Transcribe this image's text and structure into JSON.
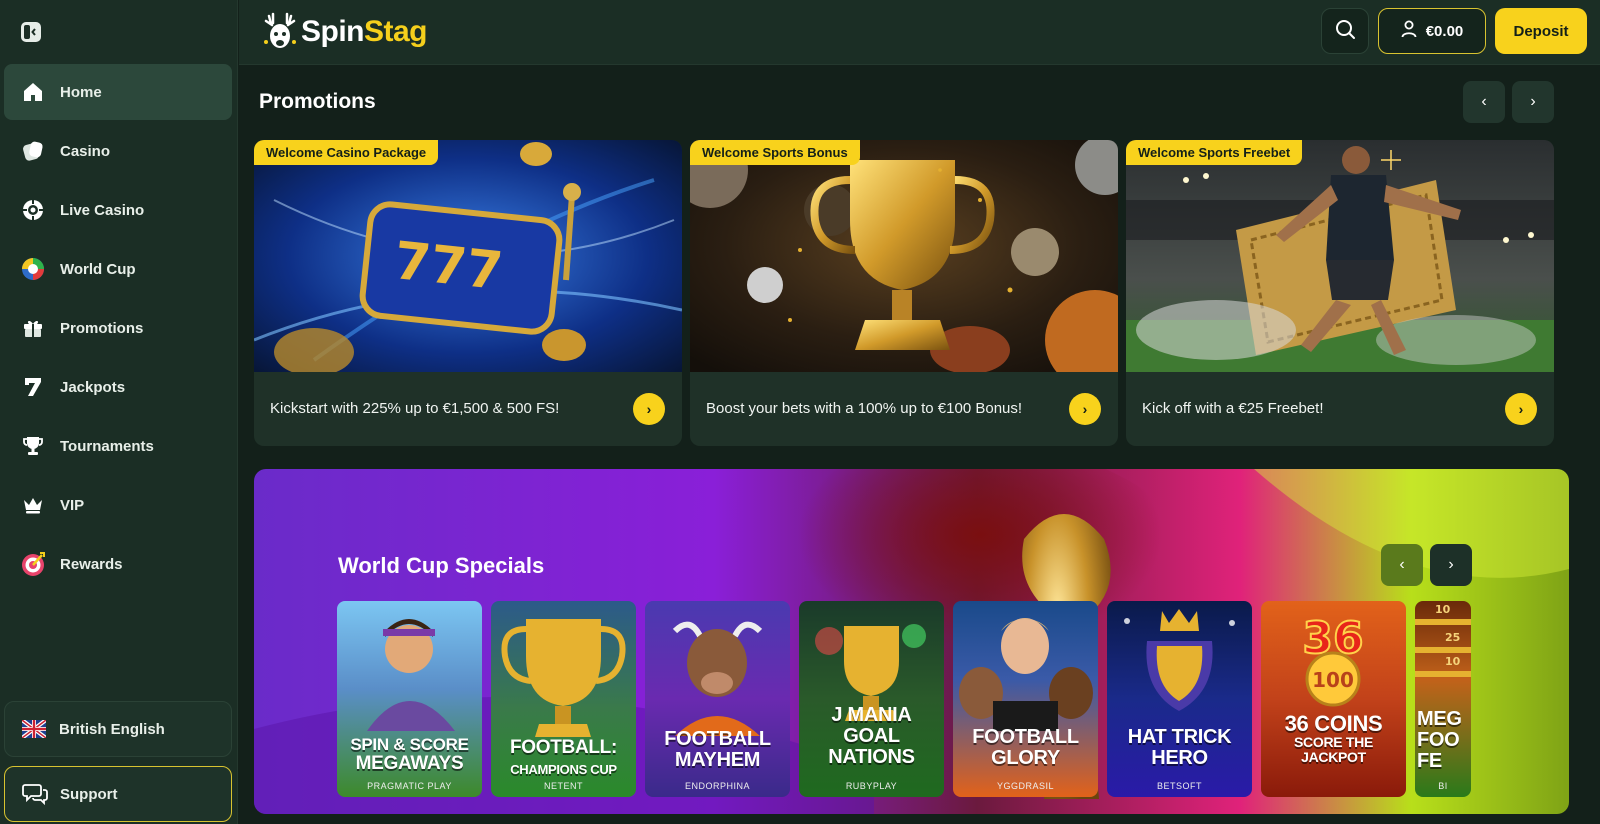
{
  "sidebar": {
    "items": [
      {
        "label": "Home",
        "icon": "home-icon"
      },
      {
        "label": "Casino",
        "icon": "casino-icon"
      },
      {
        "label": "Live Casino",
        "icon": "live-casino-icon"
      },
      {
        "label": "World Cup",
        "icon": "world-cup-icon"
      },
      {
        "label": "Promotions",
        "icon": "gift-icon"
      },
      {
        "label": "Jackpots",
        "icon": "seven-icon"
      },
      {
        "label": "Tournaments",
        "icon": "trophy-icon"
      },
      {
        "label": "VIP",
        "icon": "crown-icon"
      },
      {
        "label": "Rewards",
        "icon": "target-icon"
      }
    ],
    "language": "British English",
    "support": "Support"
  },
  "header": {
    "logo_part1": "Spin",
    "logo_part2": "Stag",
    "balance": "€0.00",
    "deposit": "Deposit"
  },
  "promotions": {
    "title": "Promotions",
    "cards": [
      {
        "badge": "Welcome Casino Package",
        "text": "Kickstart with 225% up to €1,500 & 500 FS!"
      },
      {
        "badge": "Welcome Sports Bonus",
        "text": "Boost your bets with a 100% up to €100 Bonus!"
      },
      {
        "badge": "Welcome Sports Freebet",
        "text": "Kick off with a €25 Freebet!"
      }
    ]
  },
  "world_cup": {
    "title": "World Cup Specials",
    "games": [
      {
        "line1": "SPIN & SCORE",
        "line2": "MEGAWAYS",
        "provider": "PRAGMATIC PLAY"
      },
      {
        "line1": "FOOTBALL:",
        "line2": "CHAMPIONS CUP",
        "provider": "NETENT"
      },
      {
        "line1": "FOOTBALL",
        "line2": "MAYHEM",
        "provider": "ENDORPHINA"
      },
      {
        "line1": "J MANIA",
        "line2": "GOAL NATIONS",
        "provider": "RUBYPLAY"
      },
      {
        "line1": "FOOTBALL",
        "line2": "GLORY",
        "provider": "YGGDRASIL"
      },
      {
        "line1": "HAT TRICK",
        "line2": "HERO",
        "provider": "BETSOFT"
      },
      {
        "line1": "36 COINS",
        "line2": "SCORE THE JACKPOT",
        "provider": ""
      },
      {
        "line1": "MEG",
        "line2": "FOO FE",
        "provider": "BI"
      }
    ]
  }
}
